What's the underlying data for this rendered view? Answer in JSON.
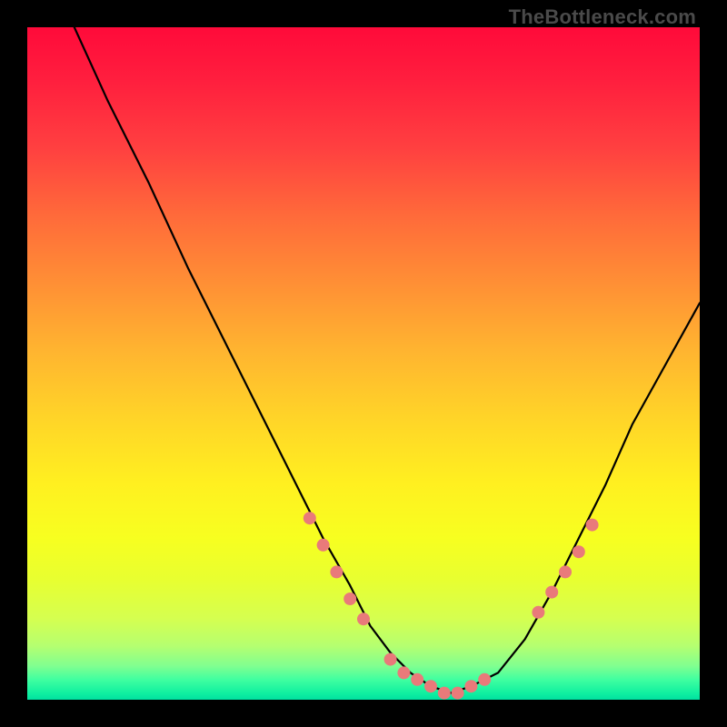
{
  "watermark": "TheBottleneck.com",
  "chart_data": {
    "type": "line",
    "title": "",
    "xlabel": "",
    "ylabel": "",
    "xlim": [
      0,
      100
    ],
    "ylim": [
      0,
      100
    ],
    "grid": false,
    "series": [
      {
        "name": "bottleneck-curve",
        "x": [
          7,
          12,
          18,
          24,
          30,
          36,
          40,
          44,
          48,
          51,
          54,
          57,
          60,
          63,
          66,
          70,
          74,
          78,
          82,
          86,
          90,
          95,
          100
        ],
        "y": [
          100,
          89,
          77,
          64,
          52,
          40,
          32,
          24,
          17,
          11,
          7,
          4,
          2,
          1,
          2,
          4,
          9,
          16,
          24,
          32,
          41,
          50,
          59
        ]
      }
    ],
    "markers": {
      "name": "highlight-points",
      "color": "#e97a7a",
      "x": [
        42,
        44,
        46,
        48,
        50,
        54,
        56,
        58,
        60,
        62,
        64,
        66,
        68,
        76,
        78,
        80,
        82,
        84
      ],
      "y": [
        27,
        23,
        19,
        15,
        12,
        6,
        4,
        3,
        2,
        1,
        1,
        2,
        3,
        13,
        16,
        19,
        22,
        26
      ]
    },
    "background_gradient": {
      "top": "#ff0a3a",
      "mid": "#ffe020",
      "bottom": "#00e0a0"
    }
  }
}
